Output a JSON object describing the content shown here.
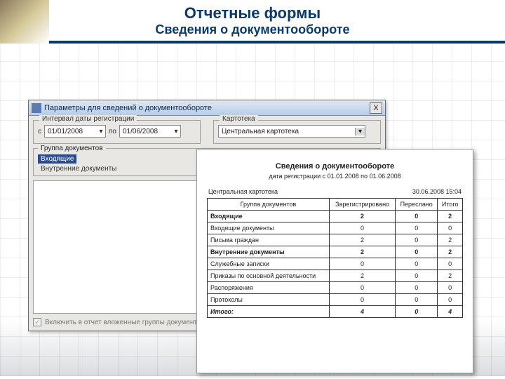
{
  "slide": {
    "title": "Отчетные формы",
    "subtitle": "Сведения о документообороте"
  },
  "dialog": {
    "title": "Параметры для сведений о документообороте",
    "close": "X",
    "interval_legend": "Интервал даты регистрации",
    "from_label": "с",
    "from_value": "01/01/2008",
    "to_label": "по",
    "to_value": "01/06/2008",
    "kartoteka_legend": "Картотека",
    "kartoteka_value": "Центральная картотека",
    "groups_legend": "Группа документов",
    "group_selected": "Входящие",
    "group_other": "Внутренние документы",
    "checkbox_label": "Включить в отчет вложенные группы документов"
  },
  "report": {
    "title": "Сведения о документообороте",
    "subtitle": "дата регистрации с 01.01.2008 по 01.06.2008",
    "kartoteka": "Центральная картотека",
    "datetime": "30.06.2008 15:04",
    "columns": [
      "Группа документов",
      "Зарегистрировано",
      "Переслано",
      "Итого"
    ],
    "rows": [
      {
        "name": "Входящие",
        "reg": "2",
        "sent": "0",
        "total": "2",
        "bold": true
      },
      {
        "name": "Входящие документы",
        "reg": "0",
        "sent": "0",
        "total": "0"
      },
      {
        "name": "Письма граждан",
        "reg": "2",
        "sent": "0",
        "total": "2"
      },
      {
        "name": "Внутренние документы",
        "reg": "2",
        "sent": "0",
        "total": "2",
        "bold": true
      },
      {
        "name": "Служебные записки",
        "reg": "0",
        "sent": "0",
        "total": "0"
      },
      {
        "name": "Приказы по основной деятельности",
        "reg": "2",
        "sent": "0",
        "total": "2"
      },
      {
        "name": "Распоряжения",
        "reg": "0",
        "sent": "0",
        "total": "0"
      },
      {
        "name": "Протоколы",
        "reg": "0",
        "sent": "0",
        "total": "0"
      }
    ],
    "totals": {
      "label": "Итого:",
      "reg": "4",
      "sent": "0",
      "total": "4"
    }
  }
}
